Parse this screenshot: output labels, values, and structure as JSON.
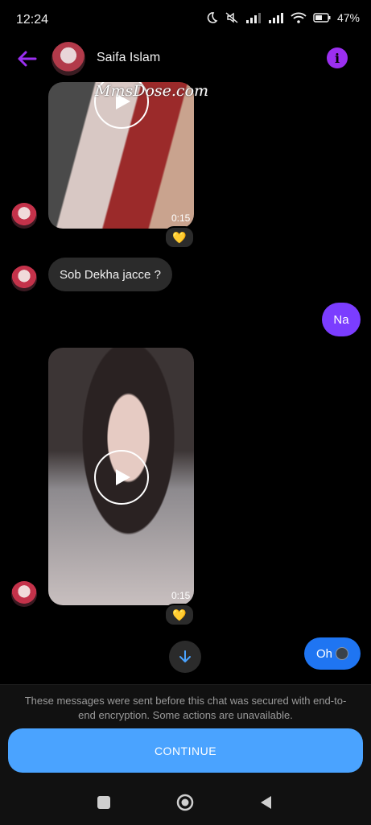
{
  "status_bar": {
    "time": "12:24",
    "battery": "47%",
    "icons": [
      "moon-icon",
      "mute-icon",
      "signal-icon",
      "signal-icon",
      "wifi-icon",
      "battery-icon"
    ]
  },
  "header": {
    "contact_name": "Saifa Islam",
    "back_icon": "arrow-left-icon",
    "info_icon": "info-icon",
    "info_symbol": "i",
    "accent_color": "#9b2ff0"
  },
  "messages": {
    "video1": {
      "duration": "0:15",
      "watermark": "MmsDose.com",
      "reaction": "💛"
    },
    "text_incoming": "Sob Dekha jacce ?",
    "text_outgoing_1": "Na",
    "video2": {
      "duration": "0:15",
      "reaction": "💛"
    },
    "text_outgoing_2": "Oh"
  },
  "footer": {
    "notice": "These messages were sent before this chat was secured with end-to-end encryption. Some actions are unavailable.",
    "continue_label": "CONTINUE",
    "continue_color": "#4aa3ff"
  },
  "colors": {
    "outgoing_purple": "#7b3dff",
    "outgoing_blue": "#1f75f2",
    "incoming_bubble": "#2b2b2b"
  }
}
